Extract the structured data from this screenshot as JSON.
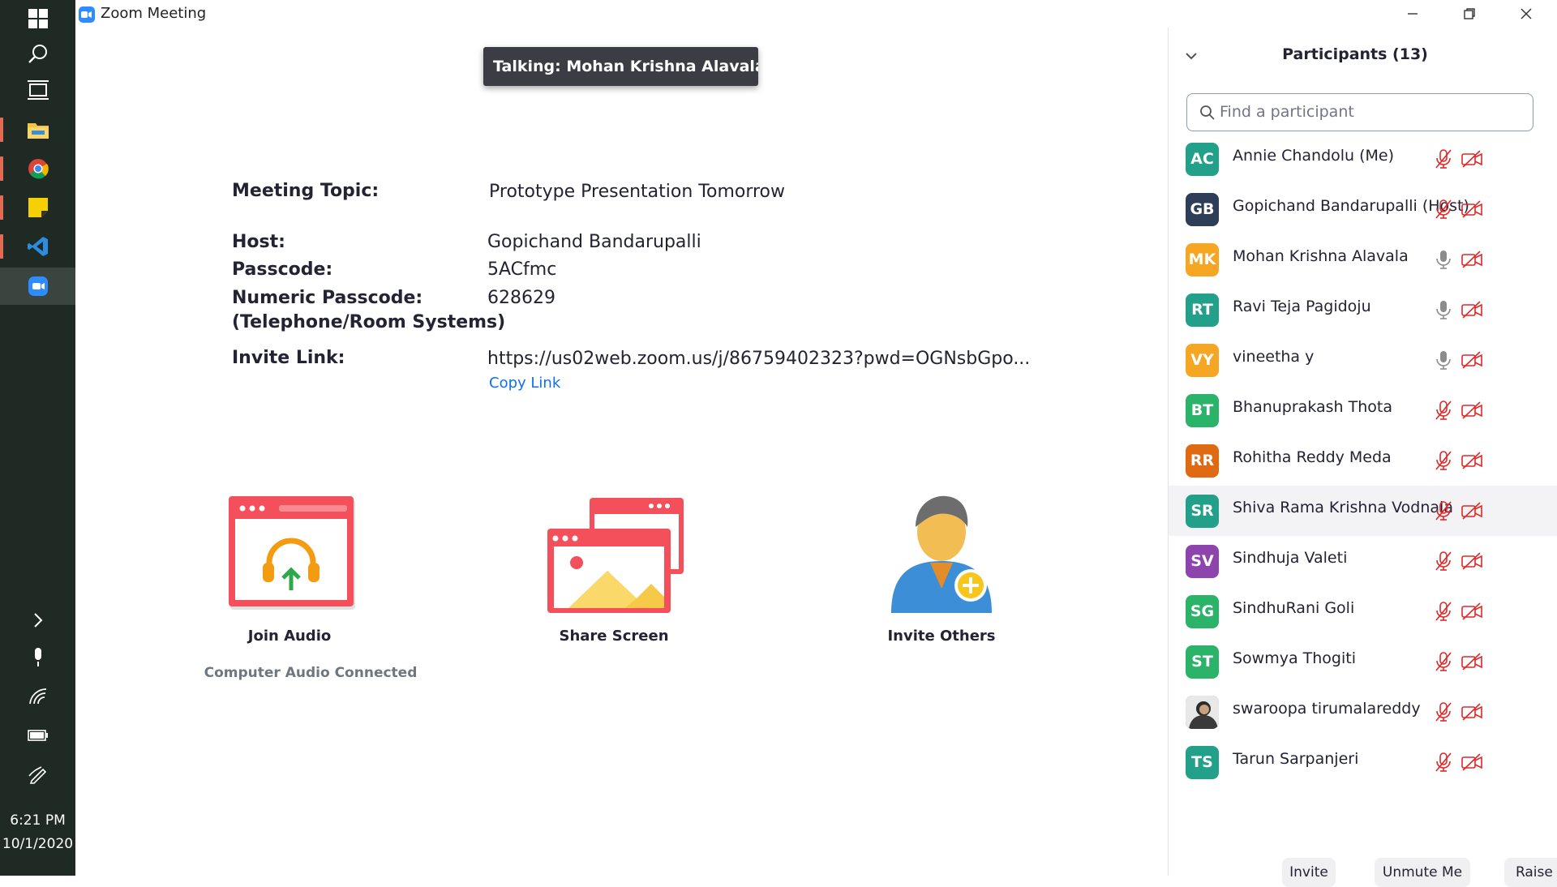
{
  "taskbar": {
    "icons": [
      "windows-icon",
      "search-icon",
      "task-view-icon",
      "file-explorer-icon",
      "chrome-icon",
      "sticky-notes-icon",
      "vscode-icon",
      "zoom-icon",
      "chevron-right-icon",
      "microphone-icon",
      "wifi-icon",
      "battery-icon",
      "pen-icon"
    ],
    "time": "6:21 PM",
    "date": "10/1/2020"
  },
  "window": {
    "title": "Zoom Meeting"
  },
  "talking": "Talking: Mohan Krishna Alavala, R...",
  "meeting": {
    "topic_label": "Meeting Topic:",
    "topic": "Prototype Presentation Tomorrow",
    "host_label": "Host:",
    "host": "Gopichand Bandarupalli",
    "passcode_label": "Passcode:",
    "passcode": "5ACfmc",
    "numeric_label_1": "Numeric Passcode:",
    "numeric_label_2": "(Telephone/Room Systems)",
    "numeric_passcode": "628629",
    "invite_label": "Invite Link:",
    "invite_link": "https://us02web.zoom.us/j/86759402323?pwd=OGNsbGpo...",
    "copy_link": "Copy Link"
  },
  "actions": {
    "join_audio": "Join Audio",
    "audio_status": "Computer Audio Connected",
    "share_screen": "Share Screen",
    "invite_others": "Invite Others"
  },
  "participants": {
    "title": "Participants (13)",
    "search_placeholder": "Find a participant",
    "list": [
      {
        "initials": "AC",
        "name": "Annie Chandolu (Me)",
        "color": "#23a08a",
        "mic": "muted",
        "video": "off"
      },
      {
        "initials": "GB",
        "name": "Gopichand Bandarupalli (Host)",
        "color": "#2f3e58",
        "mic": "muted",
        "video": "off"
      },
      {
        "initials": "MK",
        "name": "Mohan Krishna Alavala",
        "color": "#f5a623",
        "mic": "on",
        "video": "off"
      },
      {
        "initials": "RT",
        "name": "Ravi Teja Pagidoju",
        "color": "#23a08a",
        "mic": "on",
        "video": "off"
      },
      {
        "initials": "VY",
        "name": "vineetha y",
        "color": "#f5a623",
        "mic": "on",
        "video": "off"
      },
      {
        "initials": "BT",
        "name": "Bhanuprakash Thota",
        "color": "#2cb36a",
        "mic": "muted",
        "video": "off"
      },
      {
        "initials": "RR",
        "name": "Rohitha Reddy Meda",
        "color": "#e06a12",
        "mic": "muted",
        "video": "off"
      },
      {
        "initials": "SR",
        "name": "Shiva Rama Krishna Vodnala",
        "color": "#23a08a",
        "mic": "muted",
        "video": "off",
        "highlighted": true
      },
      {
        "initials": "SV",
        "name": "Sindhuja Valeti",
        "color": "#8e44ad",
        "mic": "muted",
        "video": "off"
      },
      {
        "initials": "SG",
        "name": "SindhuRani Goli",
        "color": "#2cb36a",
        "mic": "muted",
        "video": "off"
      },
      {
        "initials": "ST",
        "name": "Sowmya Thogiti",
        "color": "#2cb36a",
        "mic": "muted",
        "video": "off"
      },
      {
        "initials": "",
        "name": "swaroopa tirumalareddy",
        "color": "#5b5b5b",
        "mic": "muted",
        "video": "off",
        "photo": true
      },
      {
        "initials": "TS",
        "name": "Tarun Sarpanjeri",
        "color": "#23a08a",
        "mic": "muted",
        "video": "off"
      }
    ]
  },
  "footer": {
    "invite": "Invite",
    "unmute": "Unmute Me",
    "raise_hand": "Raise Hand"
  }
}
